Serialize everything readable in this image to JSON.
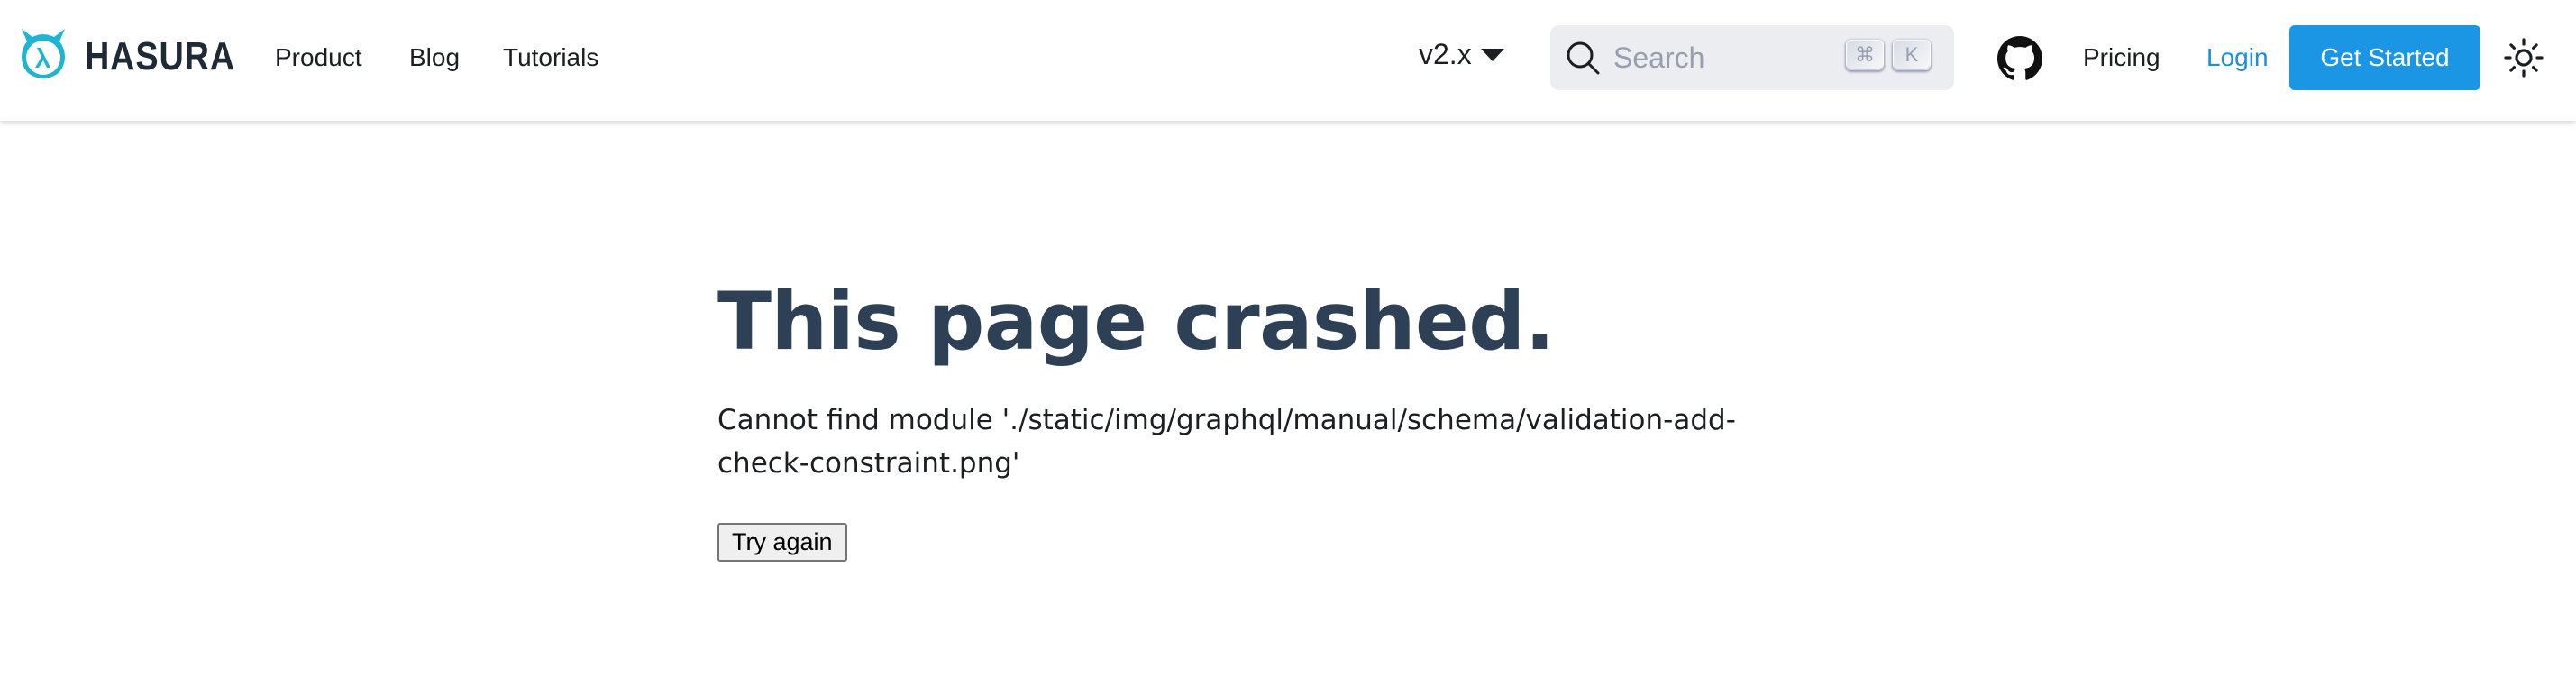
{
  "navbar": {
    "brand": {
      "name": "HASURA",
      "logo_icon": "hasura-logo-icon"
    },
    "links": [
      {
        "label": "Product"
      },
      {
        "label": "Blog"
      },
      {
        "label": "Tutorials"
      }
    ],
    "version_dropdown": {
      "selected": "v2.x"
    },
    "search": {
      "placeholder": "Search",
      "shortcut_keys": [
        "⌘",
        "K"
      ]
    },
    "github_icon": "github-icon",
    "pricing_label": "Pricing",
    "login_label": "Login",
    "cta_label": "Get Started",
    "theme_toggle_icon": "sun-icon"
  },
  "main": {
    "title": "This page crashed.",
    "message": "Cannot find module './static/img/graphql/manual/schema/validation-add-check-constraint.png'",
    "retry_label": "Try again"
  },
  "colors": {
    "brand_accent": "#1eb4d4",
    "cta_background": "#1a96e5",
    "login_link": "#1a8fd8",
    "title_text": "#2e4056"
  }
}
